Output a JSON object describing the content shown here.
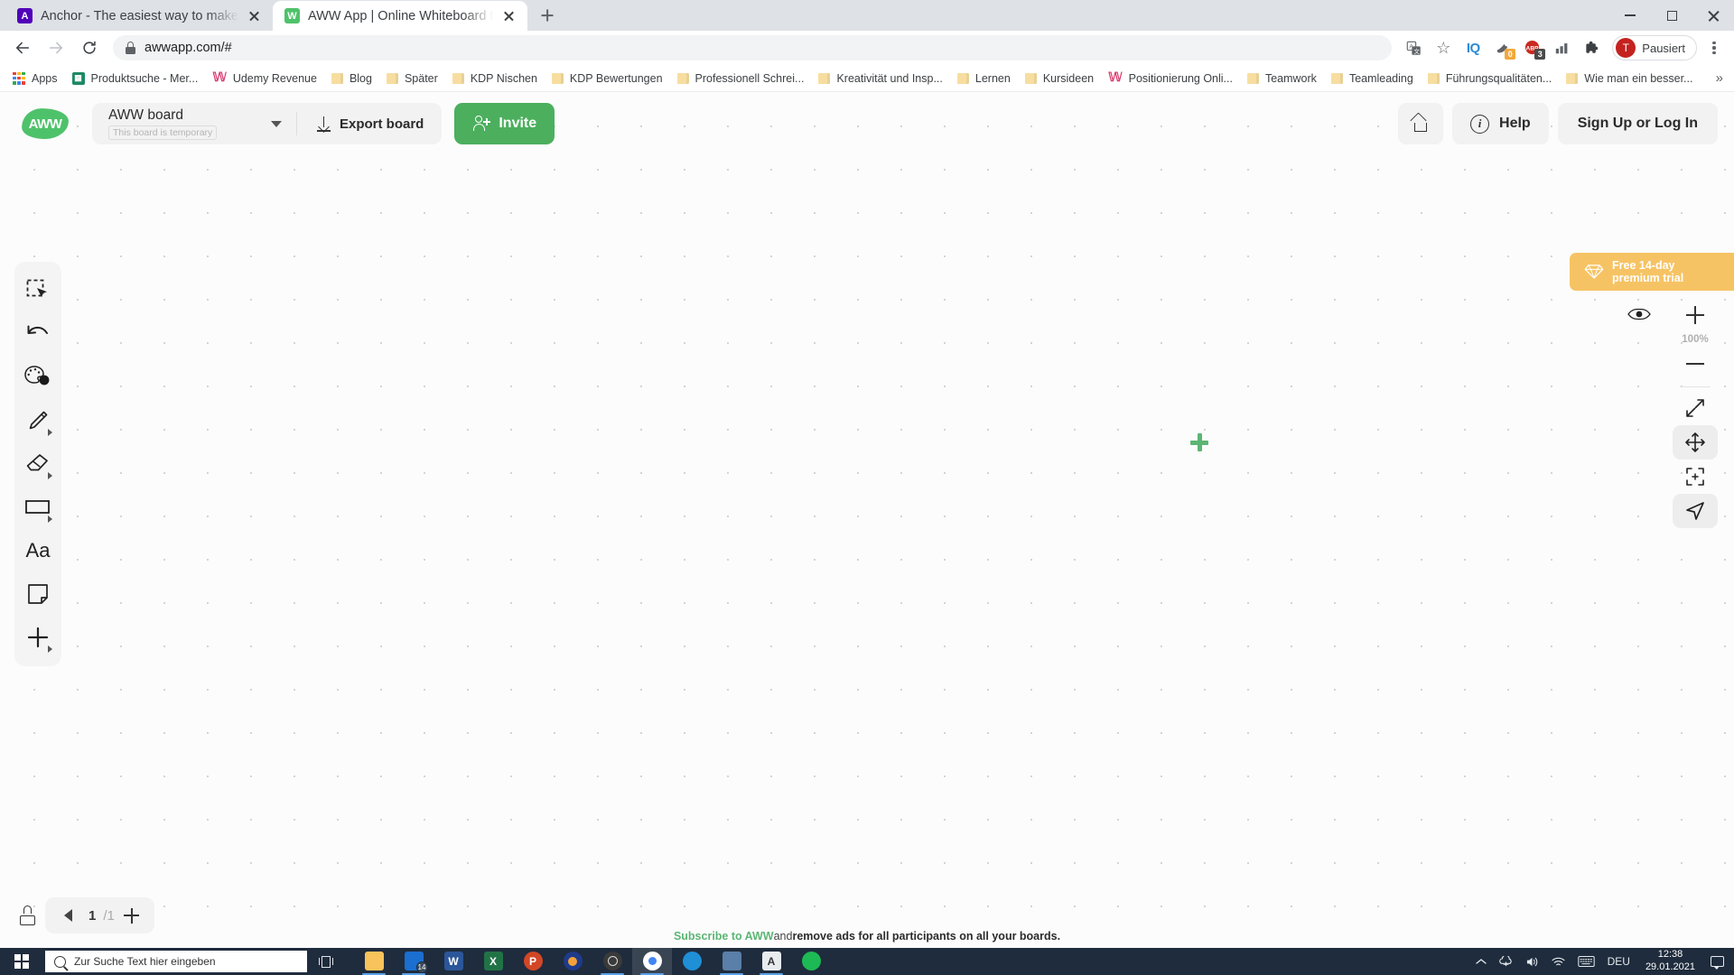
{
  "browser": {
    "tabs": [
      {
        "title": "Anchor - The easiest way to make",
        "favicon": "anchor-icon",
        "active": false
      },
      {
        "title": "AWW App | Online Whiteboard f",
        "favicon": "aww-icon",
        "active": true
      }
    ],
    "new_tab_label": "+",
    "window_controls": {
      "minimize": "minimize-icon",
      "maximize": "maximize-icon",
      "close": "close-icon"
    },
    "nav": {
      "back": "back-arrow-icon",
      "forward": "forward-arrow-icon",
      "reload": "reload-icon",
      "url": "awwapp.com/#",
      "lock": "lock-icon"
    },
    "toolbar_icons": [
      {
        "name": "translate-icon",
        "label": ""
      },
      {
        "name": "bookmark-star-icon",
        "label": "☆"
      },
      {
        "name": "iq-extension-icon",
        "label": "IQ"
      },
      {
        "name": "bird-extension-icon",
        "label": "",
        "badge": "0",
        "badge_color": "#f2a83b"
      },
      {
        "name": "adblock-extension-icon",
        "label": "ABP",
        "badge": "3",
        "badge_color": "#4a4a4a"
      },
      {
        "name": "grid-extension-icon",
        "label": ""
      },
      {
        "name": "extensions-puzzle-icon",
        "label": "🧩"
      }
    ],
    "profile": {
      "initial": "T",
      "label": "Pausiert"
    },
    "menu": "chrome-menu-icon",
    "bookmarks": [
      {
        "label": "Apps",
        "icon": "apps-grid-icon"
      },
      {
        "label": "Produktsuche - Mer...",
        "icon": "site-favicon",
        "color": "#1d8a63"
      },
      {
        "label": "Udemy Revenue",
        "icon": "udemy-icon",
        "color": "#d93a6e"
      },
      {
        "label": "Blog",
        "icon": "folder-icon"
      },
      {
        "label": "Später",
        "icon": "folder-icon"
      },
      {
        "label": "KDP Nischen",
        "icon": "folder-icon"
      },
      {
        "label": "KDP Bewertungen",
        "icon": "folder-icon"
      },
      {
        "label": "Professionell Schrei...",
        "icon": "folder-icon"
      },
      {
        "label": "Kreativität und Insp...",
        "icon": "folder-icon"
      },
      {
        "label": "Lernen",
        "icon": "folder-icon"
      },
      {
        "label": "Kursideen",
        "icon": "folder-icon"
      },
      {
        "label": "Positionierung Onli...",
        "icon": "udemy-icon",
        "color": "#d93a6e"
      },
      {
        "label": "Teamwork",
        "icon": "folder-icon"
      },
      {
        "label": "Teamleading",
        "icon": "folder-icon"
      },
      {
        "label": "Führungsqualitäten...",
        "icon": "folder-icon"
      },
      {
        "label": "Wie man ein besser...",
        "icon": "folder-icon"
      }
    ],
    "bookmarks_overflow": "»"
  },
  "aww": {
    "logo": "AWW",
    "board": {
      "name": "AWW board",
      "temporary_tag": "This board is temporary",
      "dropdown": "chevron-down-icon"
    },
    "export_label": "Export board",
    "invite_label": "Invite",
    "home_button": "home-icon",
    "help_label": "Help",
    "signup_label": "Sign Up or Log In",
    "trial_line1": "Free 14-day",
    "trial_line2": "premium trial",
    "tools": [
      {
        "name": "select-tool",
        "icon": "selection-cursor-icon",
        "has_submenu": false,
        "selected": true
      },
      {
        "name": "undo-tool",
        "icon": "undo-arrow-icon",
        "has_submenu": false
      },
      {
        "name": "color-tool",
        "icon": "color-palette-icon",
        "has_submenu": false
      },
      {
        "name": "pen-tool",
        "icon": "pencil-icon",
        "has_submenu": true
      },
      {
        "name": "eraser-tool",
        "icon": "eraser-icon",
        "has_submenu": true
      },
      {
        "name": "shape-tool",
        "icon": "rectangle-icon",
        "has_submenu": true
      },
      {
        "name": "text-tool",
        "icon": "text-aa-icon",
        "has_submenu": false
      },
      {
        "name": "note-tool",
        "icon": "sticky-note-icon",
        "has_submenu": false
      },
      {
        "name": "more-tool",
        "icon": "plus-icon",
        "has_submenu": true
      }
    ],
    "right_panel": {
      "eye": "eye-visibility-icon",
      "zoom_in": "plus-icon",
      "zoom_level": "100%",
      "zoom_out": "minus-icon",
      "fit": "expand-diagonal-icon",
      "pan": "move-arrows-icon",
      "focus": "focus-frame-icon",
      "pointer": "navigate-pointer-icon"
    },
    "canvas_cursor": "green-plus-cursor",
    "page_nav": {
      "lock": "lock-icon",
      "prev": "triangle-left-icon",
      "current": "1",
      "separator": "/1",
      "add": "plus-icon"
    },
    "footer": {
      "link": "Subscribe to AWW",
      "mid": " and ",
      "rest": "remove ads for all participants on all your boards."
    },
    "colors": {
      "brand_green": "#4ec26a",
      "invite_green": "#4caf5e",
      "trial_orange": "#f6c364"
    }
  },
  "taskbar": {
    "start": "windows-logo-icon",
    "search_placeholder": "Zur Suche Text hier eingeben",
    "task_view": "task-view-icon",
    "apps": [
      {
        "name": "file-explorer",
        "glyph": "",
        "color": "#f7c35a",
        "running": true
      },
      {
        "name": "mail",
        "glyph": "",
        "color": "#2a6fd6",
        "running": true,
        "badge": "14"
      },
      {
        "name": "word",
        "glyph": "W",
        "color": "#2b579a",
        "running": false
      },
      {
        "name": "excel",
        "glyph": "X",
        "color": "#217346",
        "running": false
      },
      {
        "name": "powerpoint",
        "glyph": "P",
        "color": "#d24726",
        "running": false
      },
      {
        "name": "audacity",
        "glyph": "",
        "color": "#1f3b8a",
        "running": false
      },
      {
        "name": "obs-studio",
        "glyph": "",
        "color": "#3a3a3a",
        "running": true
      },
      {
        "name": "google-chrome",
        "glyph": "",
        "color": "#ffffff",
        "running": true,
        "focused": true
      },
      {
        "name": "microsoft-edge",
        "glyph": "",
        "color": "#1f8fd6",
        "running": false
      },
      {
        "name": "photo-editor",
        "glyph": "",
        "color": "#5a7fa8",
        "running": true
      },
      {
        "name": "notepad-app",
        "glyph": "A",
        "color": "#dfe3e8",
        "running": true
      },
      {
        "name": "spotify",
        "glyph": "",
        "color": "#1db954",
        "running": false
      }
    ],
    "tray": {
      "chevron": "show-hidden-icons",
      "onedrive": "onedrive-icon",
      "volume": "volume-icon",
      "network": "wifi-icon",
      "keyboard": "keyboard-icon",
      "language": "DEU",
      "time": "12:38",
      "date": "29.01.2021",
      "action_center": "notification-icon"
    }
  }
}
